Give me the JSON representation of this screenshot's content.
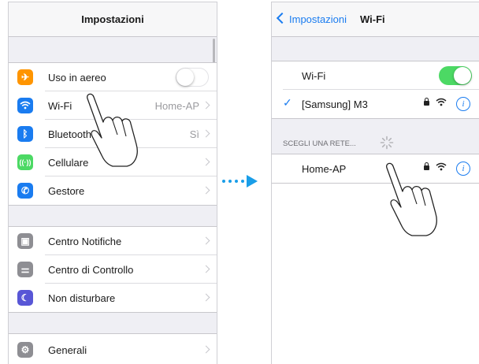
{
  "left_screen": {
    "title": "Impostazioni",
    "groups": [
      [
        {
          "label": "Uso in aereo",
          "icon": "airplane-icon",
          "icon_color": "#ff9500",
          "control": "toggle-off"
        },
        {
          "label": "Wi-Fi",
          "value": "Home-AP",
          "icon": "wifi-icon",
          "icon_color": "#1a7cf0"
        },
        {
          "label": "Bluetooth",
          "value": "Sì",
          "icon": "bluetooth-icon",
          "icon_color": "#1a7cf0"
        },
        {
          "label": "Cellulare",
          "icon": "cellular-icon",
          "icon_color": "#4cd964"
        },
        {
          "label": "Gestore",
          "icon": "phone-icon",
          "icon_color": "#1a7cf0"
        }
      ],
      [
        {
          "label": "Centro Notifiche",
          "icon": "notifications-icon",
          "icon_color": "#8e8e93"
        },
        {
          "label": "Centro di Controllo",
          "icon": "control-center-icon",
          "icon_color": "#8e8e93"
        },
        {
          "label": "Non disturbare",
          "icon": "moon-icon",
          "icon_color": "#5856d6"
        }
      ],
      [
        {
          "label": "Generali",
          "icon": "gear-icon",
          "icon_color": "#8e8e93"
        }
      ]
    ]
  },
  "right_screen": {
    "back_label": "Impostazioni",
    "title": "Wi-Fi",
    "wifi_label": "Wi-Fi",
    "wifi_enabled": true,
    "connected_network": "[Samsung] M3",
    "section_header": "SCEGLI UNA RETE...",
    "networks": [
      {
        "name": "Home-AP"
      }
    ]
  },
  "colors": {
    "accent": "#1a7cf0",
    "toggle_on": "#4cd964",
    "arrow": "#1a9ee8"
  }
}
